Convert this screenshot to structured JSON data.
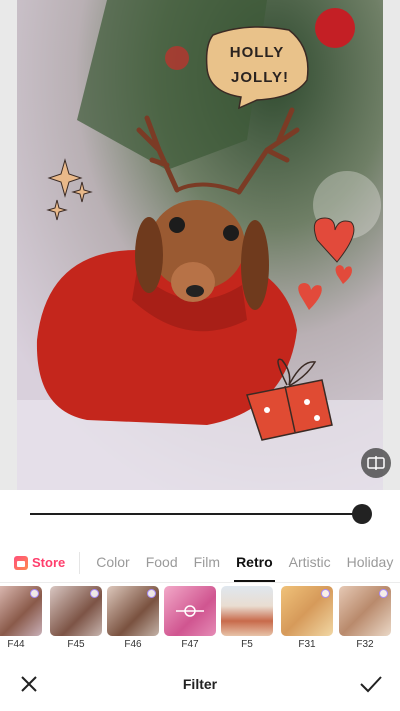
{
  "photo": {
    "sticker_text_line1": "HOLLY",
    "sticker_text_line2": "JOLLY!"
  },
  "category_tabs": {
    "store_label": "Store",
    "items": [
      "Color",
      "Food",
      "Film",
      "Retro",
      "Artistic",
      "Holiday"
    ],
    "active": "Retro"
  },
  "filters": [
    {
      "label": "F44"
    },
    {
      "label": "F45"
    },
    {
      "label": "F46"
    },
    {
      "label": "F47"
    },
    {
      "label": "F5"
    },
    {
      "label": "F31"
    },
    {
      "label": "F32"
    }
  ],
  "filter_intensity": 1.0,
  "bottom_bar": {
    "title": "Filter"
  },
  "colors": {
    "store_accent": "#ff3e6c",
    "active_tab": "#111111",
    "inactive_tab": "#9a9a9a",
    "selected_filter_tint": "#e0559a"
  },
  "icons": {
    "compare": "compare-icon",
    "close": "close-icon",
    "confirm": "checkmark-icon",
    "store": "store-icon",
    "favorite": "heart-icon"
  }
}
